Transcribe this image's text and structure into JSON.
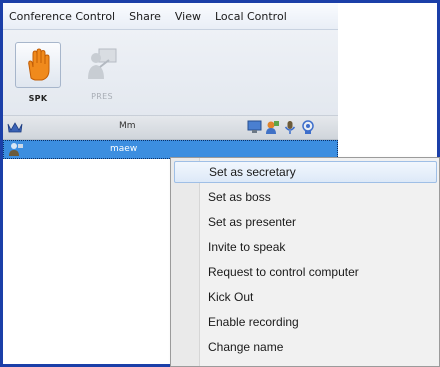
{
  "menubar": {
    "items": [
      {
        "label": "Conference Control"
      },
      {
        "label": "Share"
      },
      {
        "label": "View"
      },
      {
        "label": "Local Control"
      }
    ]
  },
  "toolbar": {
    "spk": {
      "label": "SPK",
      "icon": "raised-hand-icon"
    },
    "pres": {
      "label": "PRES",
      "icon": "presenter-icon"
    }
  },
  "list": {
    "header": {
      "name": "Mm"
    },
    "rows": [
      {
        "name": "maew"
      }
    ]
  },
  "context_menu": {
    "items": [
      {
        "label": "Set as secretary",
        "highlighted": true
      },
      {
        "label": "Set as boss"
      },
      {
        "label": "Set as presenter"
      },
      {
        "label": "Invite to speak"
      },
      {
        "label": "Request to control computer"
      },
      {
        "label": "Kick Out"
      },
      {
        "label": "Enable recording"
      },
      {
        "label": "Change name"
      }
    ]
  },
  "colors": {
    "frame": "#1b3fa8",
    "selection": "#3c8ee0",
    "hand": "#f08a1c"
  }
}
